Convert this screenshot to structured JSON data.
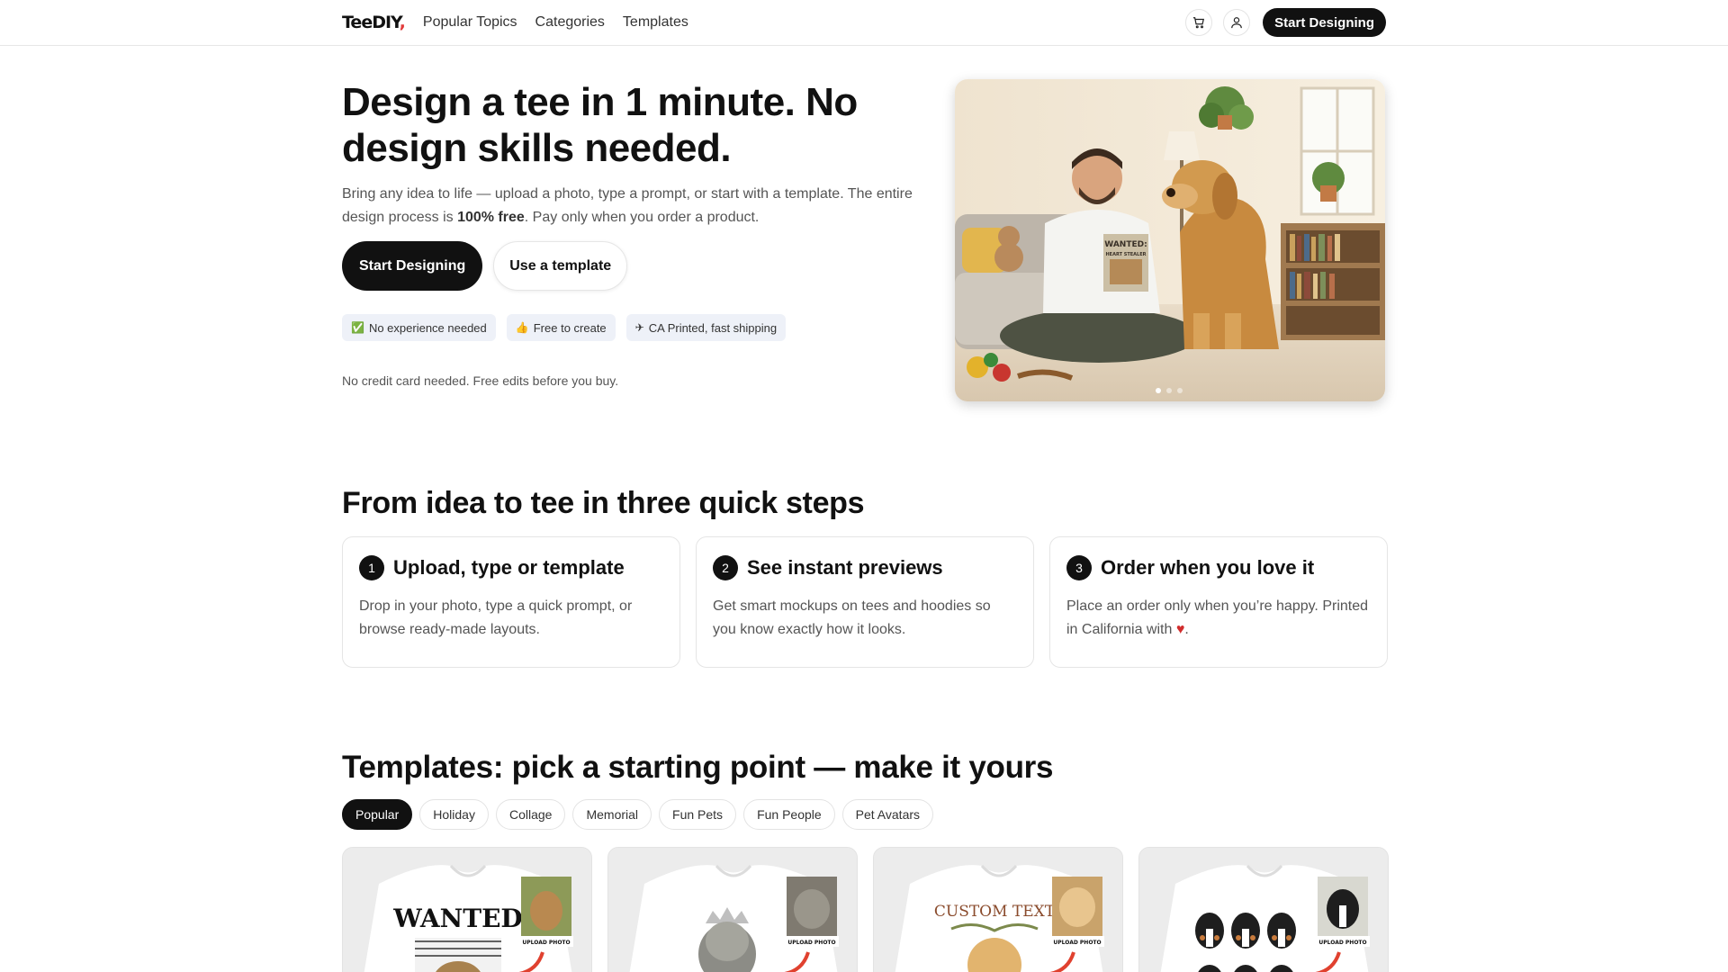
{
  "nav": {
    "logo_main": "TeeDIY",
    "logo_accent": ",",
    "links": [
      "Popular Topics",
      "Categories",
      "Templates"
    ],
    "cta": "Start Designing"
  },
  "hero": {
    "title": "Design a tee in 1 minute. No design skills needed.",
    "sub_part1": "Bring any idea to life — upload a photo, type a prompt, or start with a template. The entire design process is ",
    "sub_bold": "100% free",
    "sub_part2": ". Pay only when you order a product.",
    "primary_button": "Start Designing",
    "secondary_button": "Use a template",
    "chips": [
      {
        "icon": "✅",
        "label": "No experience needed"
      },
      {
        "icon": "👍",
        "label": "Free to create"
      },
      {
        "icon": "✈",
        "label": "CA Printed, fast shipping"
      }
    ],
    "note": "No credit card needed. Free edits before you buy.",
    "image_shirt_text_1": "WANTED:",
    "image_shirt_text_2": "HEART STEALER",
    "carousel_dots": 3,
    "carousel_active": 0
  },
  "steps": {
    "title": "From idea to tee in three quick steps",
    "items": [
      {
        "num": "1",
        "title": "Upload, type or template",
        "desc": "Drop in your photo, type a quick prompt, or browse ready-made layouts."
      },
      {
        "num": "2",
        "title": "See instant previews",
        "desc": "Get smart mockups on tees and hoodies so you know exactly how it looks."
      },
      {
        "num": "3",
        "title": "Order when you love it",
        "desc": "Place an order only when you’re happy. Printed in California with ",
        "heart": "♥",
        "desc_end": "."
      }
    ]
  },
  "templates": {
    "title": "Templates: pick a starting point — make it yours",
    "tabs": [
      "Popular",
      "Holiday",
      "Collage",
      "Memorial",
      "Fun Pets",
      "Fun People",
      "Pet Avatars"
    ],
    "active_tab": "Popular",
    "cards": [
      {
        "text": "WANTED",
        "badge": "UPLOAD PHOTO"
      },
      {
        "text": "",
        "badge": "UPLOAD PHOTO"
      },
      {
        "text": "CUSTOM TEXT",
        "badge": "UPLOAD PHOTO"
      },
      {
        "text": "",
        "badge": "UPLOAD PHOTO"
      }
    ]
  },
  "colors": {
    "primary": "#111111",
    "chip_bg": "#eef1f8",
    "heart": "#d12d2d",
    "logo_accent": "#e23b3b"
  }
}
